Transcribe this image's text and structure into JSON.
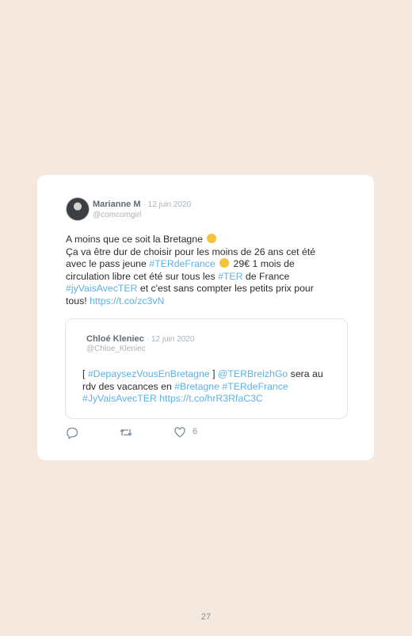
{
  "tweet": {
    "author_name": "Marianne M",
    "date": "· 12 juin 2020",
    "handle": "@comcomgirl",
    "text": {
      "line1": "A moins que ce soit la Bretagne",
      "line2a": "Ça va être dur de choisir pour les moins de 26 ans cet été avec le pass jeune ",
      "hashtag1": "#TERdeFrance",
      "line2b": " 29€ 1 mois de circulation libre cet été sur tous les ",
      "hashtag2": "#TER",
      "line2c": " de France ",
      "hashtag3": "#jyVaisAvecTER",
      "line2d": " et c'est sans compter les petits prix pour tous! ",
      "link": "https://t.co/zc3vN"
    },
    "emojis": [
      "thinking-emoji",
      "wink-emoji"
    ]
  },
  "quoted_tweet": {
    "author_name": "Chloé Kleniec",
    "date": "· 12 juin 2020",
    "handle": "@Chloe_Kleniec",
    "text": {
      "start": "[ ",
      "hashtag1": "#DepaysezVousEnBretagne",
      "mid1": " ] ",
      "mention": "@TERBreizhGo",
      "mid2": " sera au rdv des vacances en ",
      "hashtag2": "#Bretagne",
      "space": " ",
      "hashtag3": "#TERdeFrance",
      "hashtag4": "#JyVaisAvecTER",
      "link": "https://t.co/hrR3RfaC3C"
    }
  },
  "actions": {
    "reply_icon": "reply-icon",
    "retweet_icon": "retweet-icon",
    "like_icon": "heart-icon",
    "like_count": "6"
  },
  "footer": {
    "page_number": "27"
  },
  "colors": {
    "background": "#f5e8de",
    "link": "#5bb1e6",
    "muted": "#a8b2bb"
  }
}
